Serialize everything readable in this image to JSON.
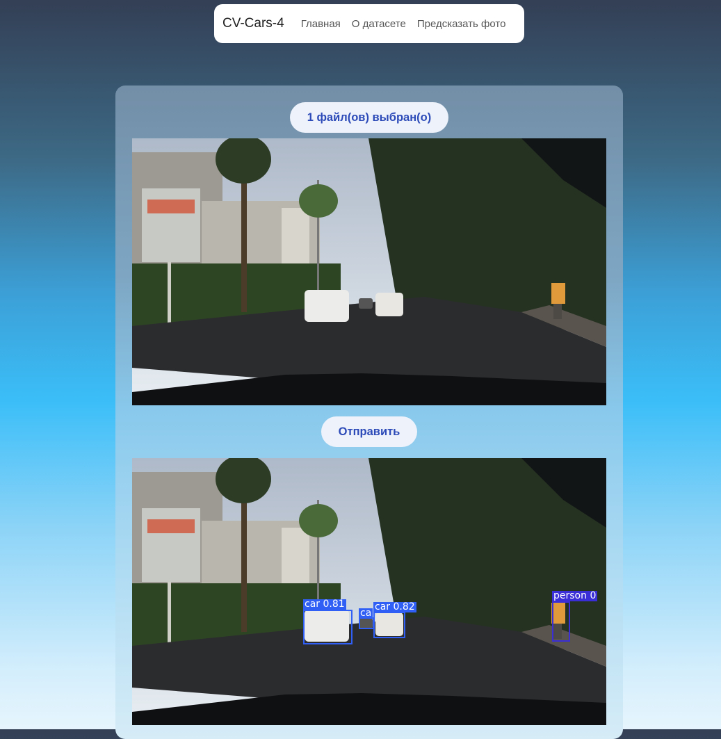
{
  "nav": {
    "brand": "CV-Cars-4",
    "links": [
      "Главная",
      "О датасете",
      "Предсказать фото"
    ]
  },
  "upload": {
    "file_status": "1 файл(ов) выбран(о)"
  },
  "submit": {
    "label": "Отправить"
  },
  "images": {
    "input_icon": "street-photo",
    "output_icon": "street-photo-with-detections"
  },
  "detections": [
    {
      "label": "car 0.81",
      "color": "#2f5ff5"
    },
    {
      "label": "ca",
      "color": "#2f5ff5"
    },
    {
      "label": "car 0.82",
      "color": "#2f5ff5"
    },
    {
      "label": "person 0",
      "color": "#3a2fd6"
    }
  ],
  "colors": {
    "accent": "#2c4ab8",
    "box": "#2f5ff5",
    "person_box": "#3a2fd6"
  }
}
